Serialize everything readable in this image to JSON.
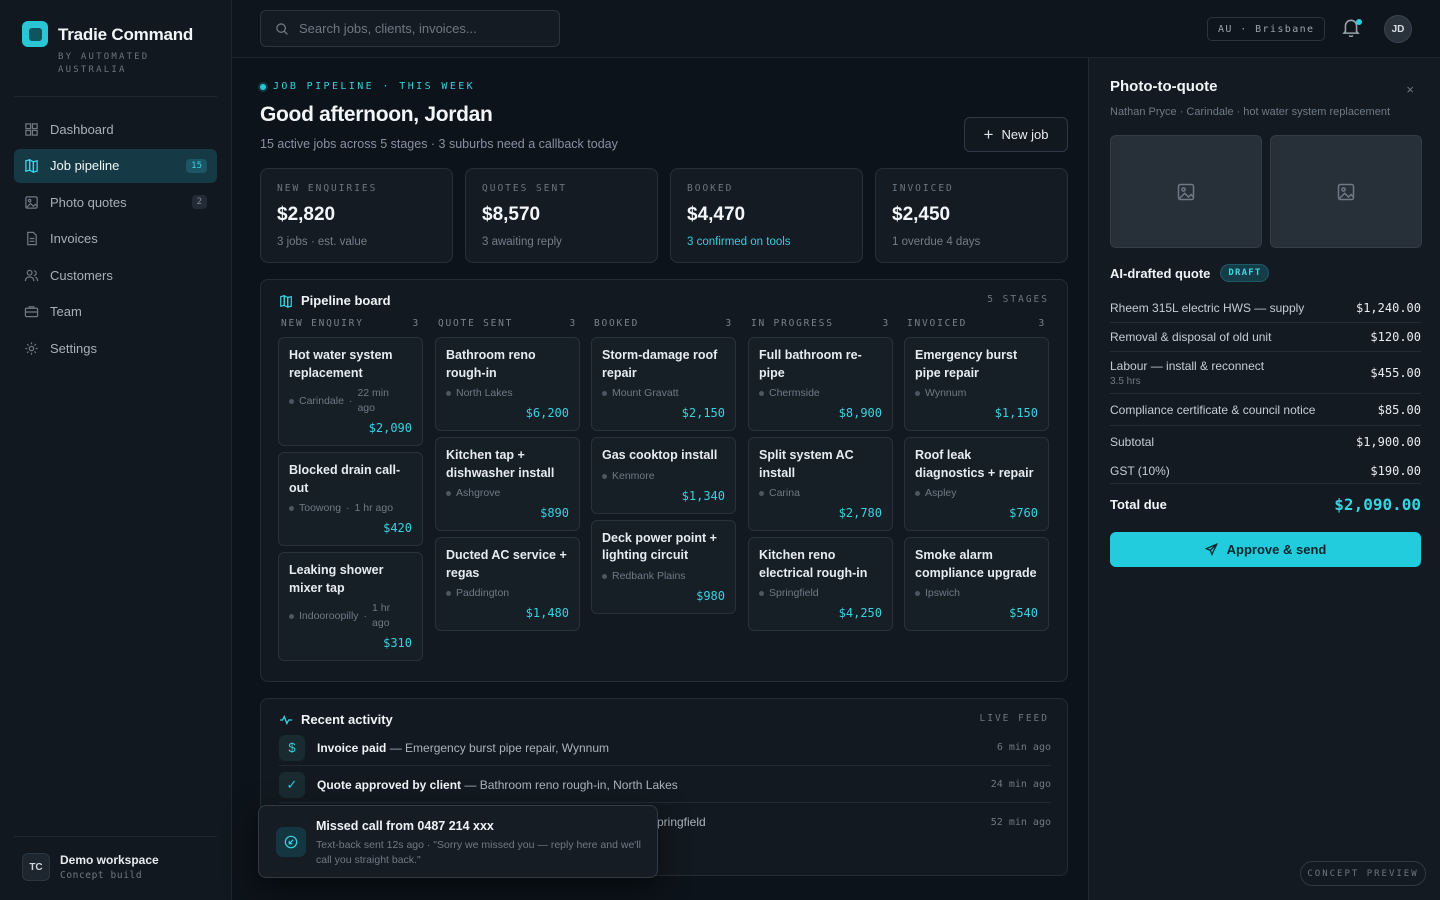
{
  "brand": {
    "title": "Tradie Command",
    "subtitle": "BY AUTOMATED AUSTRALIA"
  },
  "nav": [
    {
      "label": "Dashboard",
      "icon": "dashboard-icon",
      "badge": ""
    },
    {
      "label": "Job pipeline",
      "icon": "pipeline-icon",
      "badge": "15",
      "active": true
    },
    {
      "label": "Photo quotes",
      "icon": "image-icon",
      "badge": "2"
    },
    {
      "label": "Invoices",
      "icon": "invoice-icon",
      "badge": ""
    },
    {
      "label": "Customers",
      "icon": "customers-icon",
      "badge": ""
    },
    {
      "label": "Team",
      "icon": "briefcase-icon",
      "badge": ""
    },
    {
      "label": "Settings",
      "icon": "gear-icon",
      "badge": ""
    }
  ],
  "workspace": {
    "initials": "TC",
    "name": "Demo workspace",
    "sub": "Concept build"
  },
  "topbar": {
    "search_placeholder": "Search jobs, clients, invoices...",
    "location": "AU · Brisbane",
    "user_initials": "JD"
  },
  "header": {
    "eyebrow": "JOB PIPELINE · THIS WEEK",
    "greeting": "Good afternoon, Jordan",
    "subline": "15 active jobs across 5 stages · 3 suburbs need a callback today",
    "new_job": "New job"
  },
  "stats": [
    {
      "label": "NEW ENQUIRIES",
      "value": "$2,820",
      "note": "3 jobs · est. value",
      "accent": false
    },
    {
      "label": "QUOTES SENT",
      "value": "$8,570",
      "note": "3 awaiting reply",
      "accent": false
    },
    {
      "label": "BOOKED",
      "value": "$4,470",
      "note": "3 confirmed on tools",
      "accent": true
    },
    {
      "label": "INVOICED",
      "value": "$2,450",
      "note": "1 overdue 4 days",
      "accent": false
    }
  ],
  "board": {
    "title": "Pipeline board",
    "meta": "5 STAGES",
    "columns": [
      {
        "name": "NEW ENQUIRY",
        "count": "3",
        "cards": [
          {
            "title": "Hot water system replacement",
            "suburb": "Carindale",
            "time": "22 min ago",
            "price": "$2,090"
          },
          {
            "title": "Blocked drain call-out",
            "suburb": "Toowong",
            "time": "1 hr ago",
            "price": "$420"
          },
          {
            "title": "Leaking shower mixer tap",
            "suburb": "Indooroopilly",
            "time": "1 hr ago",
            "price": "$310"
          }
        ]
      },
      {
        "name": "QUOTE SENT",
        "count": "3",
        "cards": [
          {
            "title": "Bathroom reno rough-in",
            "suburb": "North Lakes",
            "time": "",
            "price": "$6,200"
          },
          {
            "title": "Kitchen tap + dishwasher install",
            "suburb": "Ashgrove",
            "time": "",
            "price": "$890"
          },
          {
            "title": "Ducted AC service + regas",
            "suburb": "Paddington",
            "time": "",
            "price": "$1,480"
          }
        ]
      },
      {
        "name": "BOOKED",
        "count": "3",
        "cards": [
          {
            "title": "Storm-damage roof repair",
            "suburb": "Mount Gravatt",
            "time": "",
            "price": "$2,150"
          },
          {
            "title": "Gas cooktop install",
            "suburb": "Kenmore",
            "time": "",
            "price": "$1,340"
          },
          {
            "title": "Deck power point + lighting circuit",
            "suburb": "Redbank Plains",
            "time": "",
            "price": "$980"
          }
        ]
      },
      {
        "name": "IN PROGRESS",
        "count": "3",
        "cards": [
          {
            "title": "Full bathroom re-pipe",
            "suburb": "Chermside",
            "time": "",
            "price": "$8,900"
          },
          {
            "title": "Split system AC install",
            "suburb": "Carina",
            "time": "",
            "price": "$2,780"
          },
          {
            "title": "Kitchen reno electrical rough-in",
            "suburb": "Springfield",
            "time": "",
            "price": "$4,250"
          }
        ]
      },
      {
        "name": "INVOICED",
        "count": "3",
        "cards": [
          {
            "title": "Emergency burst pipe repair",
            "suburb": "Wynnum",
            "time": "",
            "price": "$1,150"
          },
          {
            "title": "Roof leak diagnostics + repair",
            "suburb": "Aspley",
            "time": "",
            "price": "$760"
          },
          {
            "title": "Smoke alarm compliance upgrade",
            "suburb": "Ipswich",
            "time": "",
            "price": "$540"
          }
        ]
      }
    ]
  },
  "activity": {
    "title": "Recent activity",
    "meta": "LIVE FEED",
    "items": [
      {
        "icon": "$",
        "bold": "Invoice paid",
        "rest": " — Emergency burst pipe repair, Wynnum",
        "time": "6 min ago"
      },
      {
        "icon": "✓",
        "bold": "Quote approved by client",
        "rest": " — Bathroom reno rough-in, North Lakes",
        "time": "24 min ago"
      },
      {
        "icon": "",
        "bold": "",
        "rest": "pringfield",
        "time": "52 min ago"
      }
    ]
  },
  "toast": {
    "title": "Missed call from 0487 214 xxx",
    "body": "Text-back sent 12s ago · \"Sorry we missed you — reply here and we'll call you straight back.\""
  },
  "panel": {
    "title": "Photo-to-quote",
    "close": "×",
    "subtitle": "Nathan Pryce · Carindale · hot water system replacement",
    "quote_title": "AI-drafted quote",
    "status": "DRAFT",
    "lines": [
      {
        "label": "Rheem 315L electric HWS — supply",
        "sub": "",
        "amount": "$1,240.00"
      },
      {
        "label": "Removal & disposal of old unit",
        "sub": "",
        "amount": "$120.00"
      },
      {
        "label": "Labour — install & reconnect",
        "sub": "3.5 hrs",
        "amount": "$455.00"
      },
      {
        "label": "Compliance certificate & council notice",
        "sub": "",
        "amount": "$85.00"
      }
    ],
    "subtotal_label": "Subtotal",
    "subtotal": "$1,900.00",
    "gst_label": "GST (10%)",
    "gst": "$190.00",
    "total_label": "Total due",
    "total": "$2,090.00",
    "approve": "Approve & send",
    "concept": "CONCEPT PREVIEW"
  }
}
